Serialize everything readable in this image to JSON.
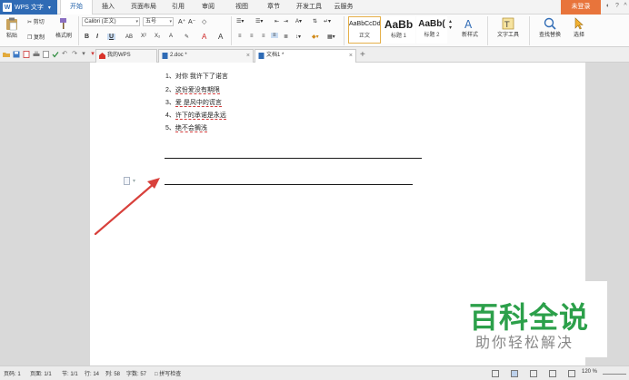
{
  "app": {
    "name": "WPS 文字",
    "login_label": "未登录"
  },
  "menu": {
    "tabs": [
      "开始",
      "插入",
      "页面布局",
      "引用",
      "审阅",
      "视图",
      "章节",
      "开发工具",
      "云服务"
    ]
  },
  "ribbon": {
    "paste": "粘贴",
    "cut": "剪切",
    "copy": "复制",
    "format_painter": "格式刷",
    "font_name": "Calibri (正文)",
    "font_size": "五号",
    "styles": [
      {
        "preview": "AaBbCcDd",
        "label": "正文"
      },
      {
        "preview": "AaBb",
        "label": "标题 1"
      },
      {
        "preview": "AaBb(",
        "label": "标题 2"
      }
    ],
    "new_style": "新样式",
    "text_tools": "文字工具",
    "find_replace": "查找替换",
    "select": "选择"
  },
  "doc_tabs": {
    "tabs": [
      {
        "label": "我的WPS"
      },
      {
        "label": "2.doc *"
      },
      {
        "label": "文档1 *"
      }
    ]
  },
  "document": {
    "lines": [
      {
        "num": "1、",
        "text": "对你  我许下了诺言"
      },
      {
        "num": "2、",
        "text": "这份爱没有期限"
      },
      {
        "num": "3、",
        "text": "爱  是风中的谎言"
      },
      {
        "num": "4、",
        "text": "许下的承诺是永远"
      },
      {
        "num": "5、",
        "text": "绝不会搁浅"
      }
    ]
  },
  "watermark": {
    "title": "百科全说",
    "subtitle": "助你轻松解决"
  },
  "status": {
    "page": "页码: 1",
    "pages": "页面: 1/1",
    "section": "节: 1/1",
    "row": "行: 14",
    "col": "列: 58",
    "words": "字数: 57",
    "spell": "拼写检查",
    "zoom": "120 %"
  },
  "colors": {
    "accent": "#2f6bb5",
    "login": "#e8743b",
    "watermark_green": "#2ca04a",
    "arrow_red": "#d8403b"
  }
}
